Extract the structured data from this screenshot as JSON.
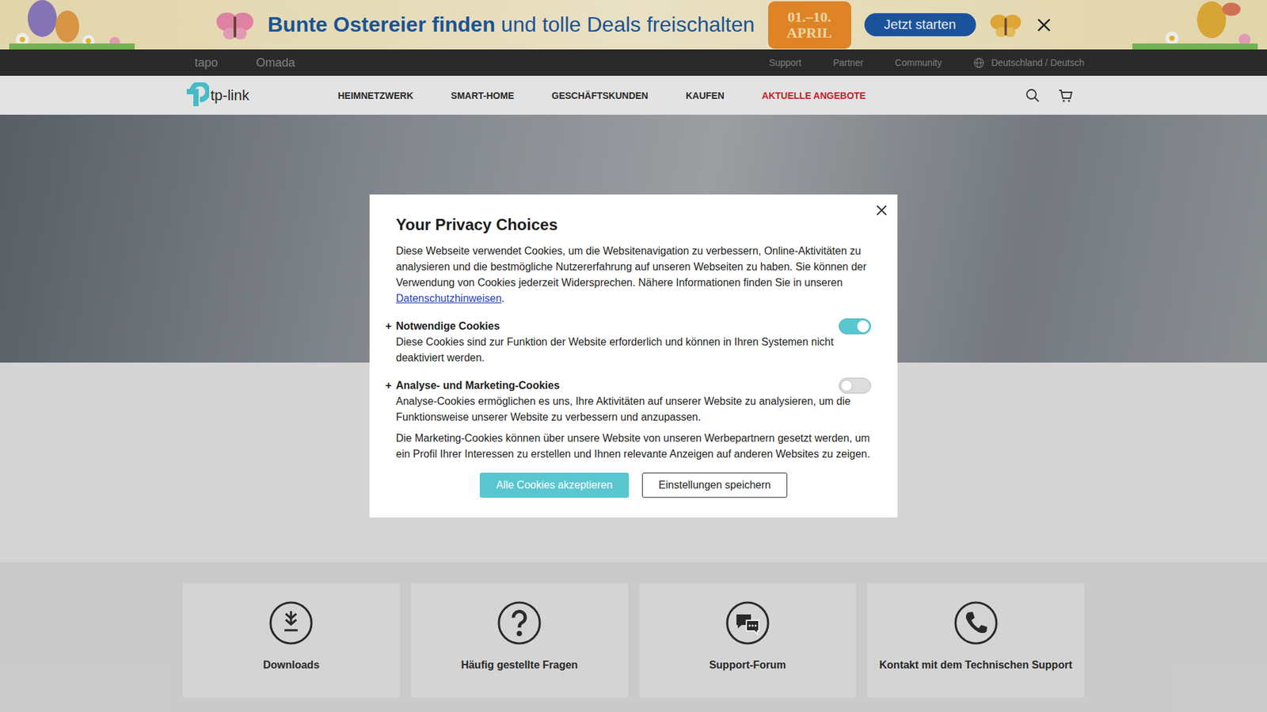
{
  "banner": {
    "headline_bold": "Bunte Ostereier finden",
    "headline_rest": "und tolle Deals freischalten",
    "date_lines": [
      "01.–10.",
      "APRIL"
    ],
    "button": "Jetzt starten"
  },
  "top_bar": {
    "brands": [
      "tapo",
      "Omada"
    ],
    "links": [
      "Support",
      "Partner",
      "Community"
    ],
    "region": "Deutschland / Deutsch"
  },
  "nav": {
    "logo": "tp-link",
    "items": [
      {
        "label": "HEIMNETZWERK",
        "highlighted": false
      },
      {
        "label": "SMART-HOME",
        "highlighted": false
      },
      {
        "label": "GESCHÄFTSKUNDEN",
        "highlighted": false
      },
      {
        "label": "KAUFEN",
        "highlighted": false
      },
      {
        "label": "AKTUELLE ANGEBOTE",
        "highlighted": true
      }
    ]
  },
  "support_cards": [
    {
      "label": "Downloads",
      "kind": "download"
    },
    {
      "label": "Häufig gestellte Fragen",
      "kind": "faq"
    },
    {
      "label": "Support-Forum",
      "kind": "forum"
    },
    {
      "label": "Kontakt mit dem Technischen Support",
      "kind": "phone"
    }
  ],
  "privacy_dialog": {
    "title": "Your Privacy Choices",
    "intro": "Diese Webseite verwendet Cookies, um die Websitenavigation zu verbessern, Online-Aktivitäten zu analysieren und die bestmögliche Nutzererfahrung auf unseren Webseiten zu haben. Sie können der Verwendung von Cookies jederzeit Widersprechen. Nähere Informationen finden Sie in unseren",
    "link": "Datenschutzhinweisen",
    "intro_end": ".",
    "sections": [
      {
        "expander": "+",
        "title": "Notwendige Cookies",
        "on": true,
        "paragraphs": [
          "Diese Cookies sind zur Funktion der Website erforderlich und können in Ihren Systemen nicht deaktiviert werden."
        ]
      },
      {
        "expander": "+",
        "title": "Analyse- und Marketing-Cookies",
        "on": false,
        "paragraphs": [
          "Analyse-Cookies ermöglichen es uns, Ihre Aktivitäten auf unserer Website zu analysieren, um die Funktionsweise unserer Website zu verbessern und anzupassen.",
          "Die Marketing-Cookies können über unsere Website von unseren Werbepartnern gesetzt werden, um ein Profil Ihrer Interessen zu erstellen und Ihnen relevante Anzeigen auf anderen Websites zu zeigen."
        ]
      }
    ],
    "buttons": [
      {
        "label": "Alle Cookies akzeptieren",
        "primary": true
      },
      {
        "label": "Einstellungen speichern",
        "primary": false
      }
    ]
  }
}
